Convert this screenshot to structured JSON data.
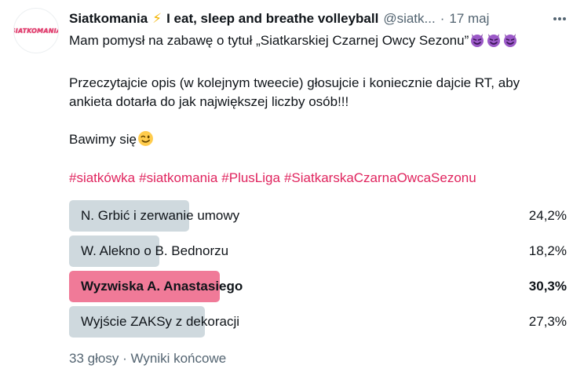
{
  "tweet": {
    "avatar_text": "SIATKOMANIA",
    "author": "Siatkomania",
    "author_suffix": "I eat, sleep and breathe volleyball",
    "handle": "@siatk...",
    "separator": "·",
    "time": "17 maj",
    "more_icon": "more-horizontal-icon",
    "line1": "Mam pomysł na zabawę o tytuł „Siatkarskiej Czarnej Owcy Sezonu”",
    "line2": "Przeczytajcie opis (w kolejnym tweecie) głosujcie i koniecznie dajcie RT, aby",
    "line3": "ankieta dotarła do jak największej liczby osób!!!",
    "line4": "Bawimy się",
    "hashtags": [
      "#siatkówka",
      "#siatkomania",
      "#PlusLiga",
      "#SiatkarskaCzarnaOwcaSezonu"
    ]
  },
  "poll": {
    "options": [
      {
        "label": "N. Grbić i zerwanie umowy",
        "percent_text": "24,2%",
        "percent": 24.2,
        "winner": false
      },
      {
        "label": "W. Alekno o B. Bednorzu",
        "percent_text": "18,2%",
        "percent": 18.2,
        "winner": false
      },
      {
        "label": "Wyzwiska A. Anastasiego",
        "percent_text": "30,3%",
        "percent": 30.3,
        "winner": true
      },
      {
        "label": "Wyjście ZAKSy z dekoracji",
        "percent_text": "27,3%",
        "percent": 27.3,
        "winner": false
      }
    ],
    "votes": "33 głosy",
    "separator": "·",
    "status": "Wyniki końcowe",
    "winner_color": "#f07a98",
    "bar_color": "#cfd9de"
  }
}
